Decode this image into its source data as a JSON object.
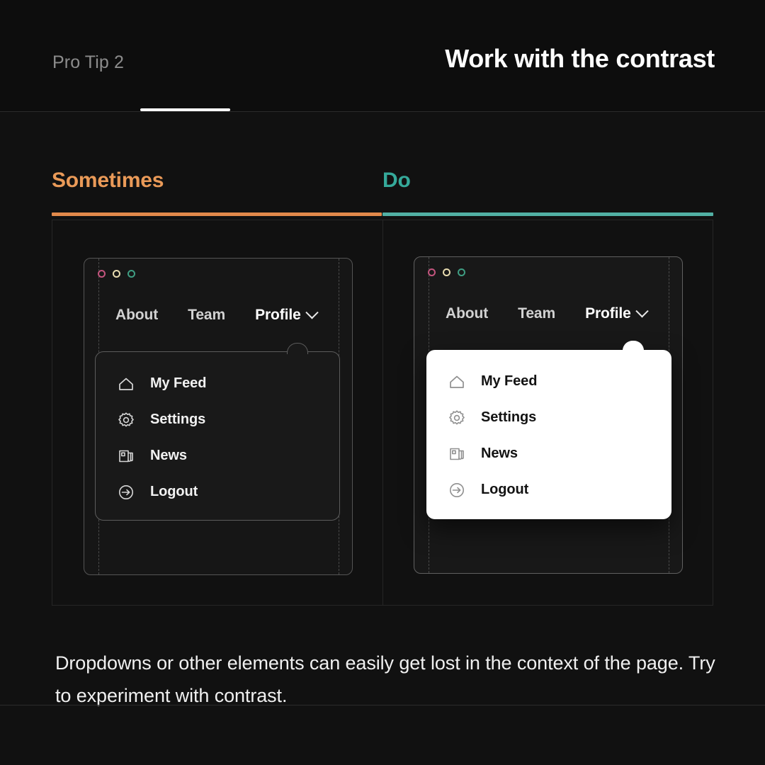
{
  "header": {
    "eyebrow": "Pro Tip 2",
    "title": "Work with the contrast"
  },
  "columns": {
    "left": {
      "label": "Sometimes",
      "accent": "#e28a4b",
      "text_color": "#ea9a58"
    },
    "right": {
      "label": "Do",
      "accent": "#52b0a4",
      "text_color": "#35a99a"
    }
  },
  "browser": {
    "window_dots": [
      {
        "name": "close-dot",
        "color": "#c4557e"
      },
      {
        "name": "minimize-dot",
        "color": "#e8dcb0"
      },
      {
        "name": "maximize-dot",
        "color": "#3f9e83"
      }
    ],
    "nav": [
      {
        "label": "About",
        "active": false
      },
      {
        "label": "Team",
        "active": false
      },
      {
        "label": "Profile",
        "active": true
      }
    ]
  },
  "dropdown": {
    "items": [
      {
        "label": "My Feed",
        "icon": "home-icon"
      },
      {
        "label": "Settings",
        "icon": "gear-icon"
      },
      {
        "label": "News",
        "icon": "news-icon"
      },
      {
        "label": "Logout",
        "icon": "logout-icon"
      }
    ]
  },
  "caption": "Dropdowns or other elements can easily get lost in the context of the page. Try to experiment with contrast."
}
